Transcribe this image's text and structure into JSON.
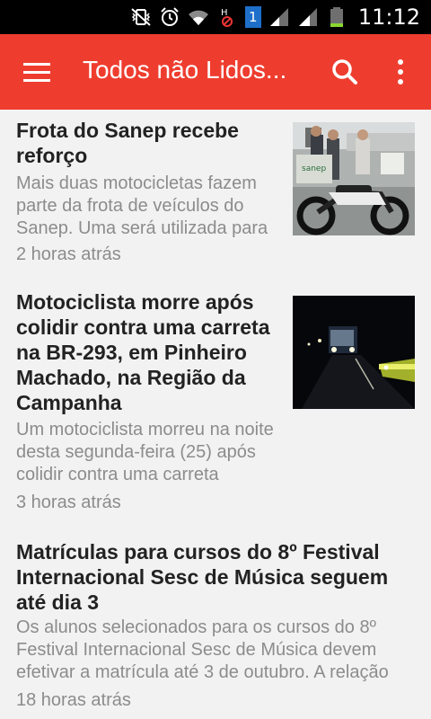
{
  "status_bar": {
    "time": "11:12",
    "sim_label": "1",
    "icons": [
      "mute-vibrate-icon",
      "alarm-icon",
      "wifi-icon",
      "no-hspa-icon",
      "sim-icon",
      "signal-icon",
      "signal-icon",
      "battery-icon"
    ]
  },
  "app_bar": {
    "title": "Todos não Lidos...",
    "background_color": "#ee3d2f"
  },
  "articles": [
    {
      "title": "Frota do Sanep recebe reforço",
      "summary": "Mais duas motocicletas fazem parte da frota de veículos do Sanep. Uma será utilizada para",
      "time": "2 horas atrás",
      "image_text": "sanep"
    },
    {
      "title": "Motociclista morre após colidir contra uma carreta na BR-293, em Pinheiro Machado, na Região da Campanha",
      "summary": "Um motociclista morreu na noite desta segunda-feira (25) após colidir contra uma carreta",
      "time": "3 horas atrás"
    },
    {
      "title": "Matrículas para cursos do 8º Festival Internacional Sesc de Música seguem até dia 3",
      "summary": "Os alunos selecionados para os cursos do 8º Festival Internacional Sesc de Música devem efetivar a matrícula até 3 de outubro. A relação",
      "time": "18 horas atrás"
    }
  ]
}
